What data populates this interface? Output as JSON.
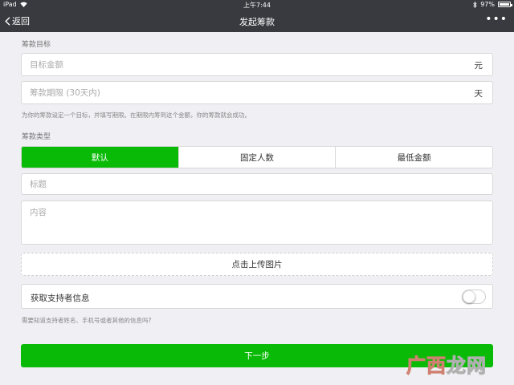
{
  "status_bar": {
    "device": "iPad",
    "time": "上午7:44",
    "battery": "97%",
    "battery_level": 0.97
  },
  "nav": {
    "back_label": "返回",
    "title": "发起筹款",
    "more_label": "•••"
  },
  "goal": {
    "section_label": "筹款目标",
    "amount_placeholder": "目标金额",
    "amount_unit": "元",
    "period_placeholder": "筹款期限 (30天内)",
    "period_unit": "天",
    "hint": "为你的筹款设定一个目标，并填写期限。在期限内筹到这个金额，你的筹款就会成功。"
  },
  "type": {
    "section_label": "筹款类型",
    "options": [
      "默认",
      "固定人数",
      "最低金额"
    ],
    "selected_index": 0
  },
  "content": {
    "title_placeholder": "标题",
    "body_placeholder": "内容",
    "upload_label": "点击上传图片"
  },
  "supporter": {
    "toggle_label": "获取支持者信息",
    "toggle_on": false,
    "hint": "需要知道支持者姓名、手机号或者其他的信息吗?"
  },
  "actions": {
    "next_label": "下一步"
  },
  "watermark": {
    "text_accent": "广西",
    "text_main": "龙网"
  },
  "colors": {
    "accent": "#09bb07",
    "nav_bg": "#393a3f",
    "page_bg": "#efeff4"
  }
}
